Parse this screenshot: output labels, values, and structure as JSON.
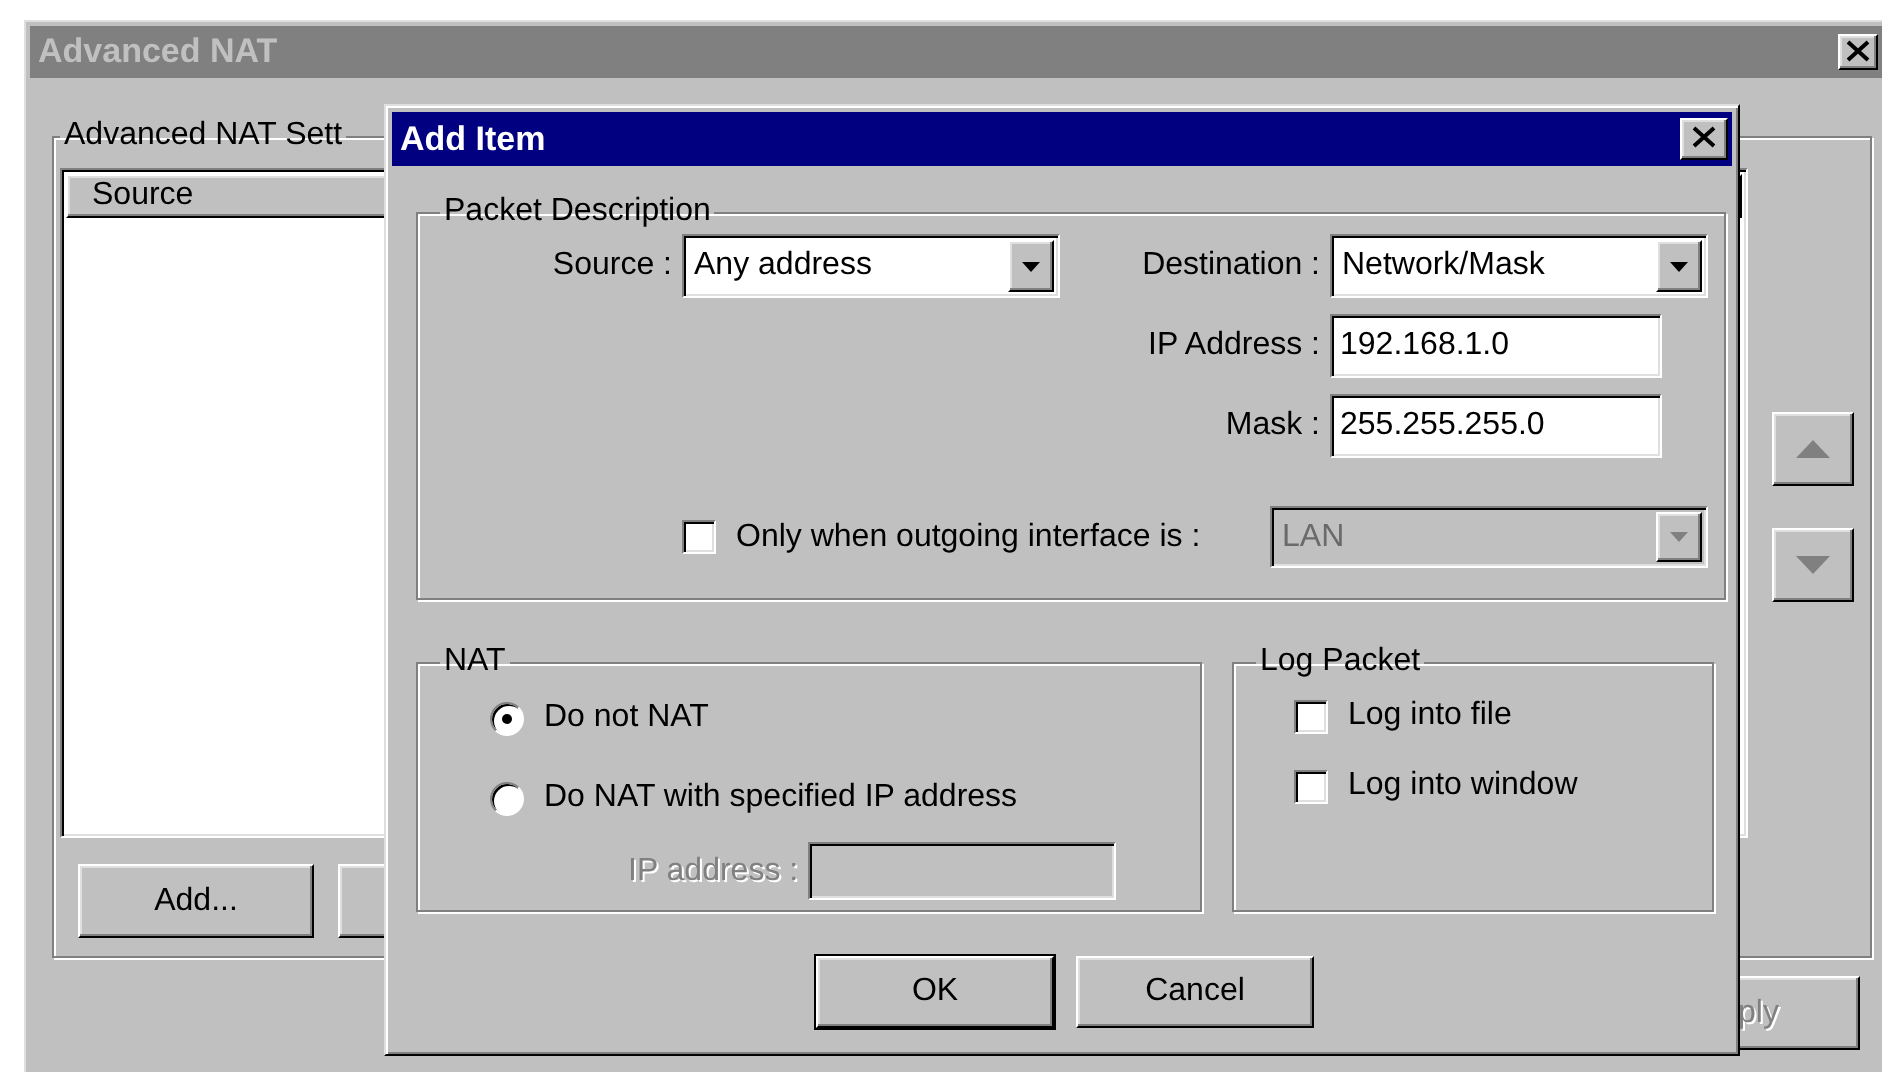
{
  "background_window": {
    "title": "Advanced NAT",
    "active": false,
    "group_label": "Advanced NAT Sett",
    "list_columns": [
      "Source"
    ],
    "buttons": [
      {
        "label": "Add...",
        "disabled": false
      }
    ],
    "apply_button": {
      "label": "ply",
      "disabled": true
    }
  },
  "dialog": {
    "title": "Add Item",
    "active": true,
    "packet_description": {
      "label": "Packet Description",
      "source": {
        "label": "Source :",
        "value": "Any address"
      },
      "destination": {
        "label": "Destination :",
        "value": "Network/Mask"
      },
      "ip_address": {
        "label": "IP Address :",
        "value": "192.168.1.0"
      },
      "mask": {
        "label": "Mask :",
        "value": "255.255.255.0"
      },
      "outgoing_interface": {
        "label": "Only when outgoing interface is :",
        "checked": false,
        "value": "LAN",
        "disabled": true
      }
    },
    "nat": {
      "label": "NAT",
      "options": [
        {
          "label": "Do not NAT",
          "selected": true
        },
        {
          "label": "Do NAT with specified IP address",
          "selected": false
        }
      ],
      "ip_address": {
        "label": "IP address :",
        "disabled": true
      }
    },
    "log_packet": {
      "label": "Log Packet",
      "options": [
        {
          "label": "Log into file",
          "checked": false
        },
        {
          "label": "Log into window",
          "checked": false
        }
      ]
    },
    "buttons": [
      {
        "label": "OK",
        "default": true
      },
      {
        "label": "Cancel",
        "default": false
      }
    ]
  }
}
